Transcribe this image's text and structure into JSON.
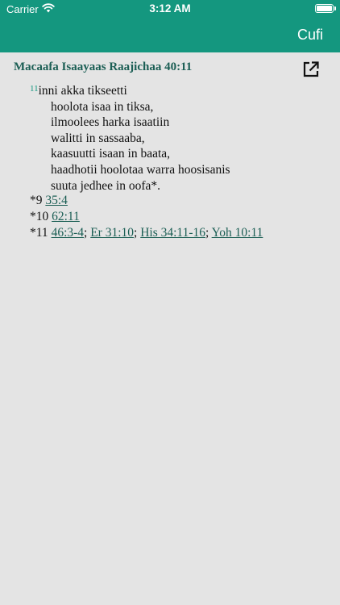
{
  "status_bar": {
    "carrier": "Carrier",
    "time": "3:12 AM",
    "battery_level": 1.0
  },
  "nav": {
    "action_label": "Cufi"
  },
  "reference": {
    "title": "Macaafa Isaayaas Raajichaa 40:11",
    "open_icon": "open-external-icon"
  },
  "verse": {
    "number": "11",
    "first_line": "inni akka tikseetti",
    "lines": [
      "hoolota isaa in tiksa,",
      "ilmoolees harka isaatiin",
      "walitti in sassaaba,",
      "kaasuutti isaan in baata,",
      "haadhotii hoolotaa warra hoosisanis",
      "suuta jedhee in oofa*."
    ]
  },
  "notes": [
    {
      "marker": "*9",
      "refs": [
        "35:4"
      ]
    },
    {
      "marker": "*10",
      "refs": [
        "62:11"
      ]
    },
    {
      "marker": "*11",
      "refs": [
        "46:3-4",
        "Er 31:10",
        "His 34:11-16",
        "Yoh 10:11"
      ]
    }
  ],
  "colors": {
    "header": "#14977f",
    "link": "#1b5e54",
    "background": "#e4e4e4"
  }
}
